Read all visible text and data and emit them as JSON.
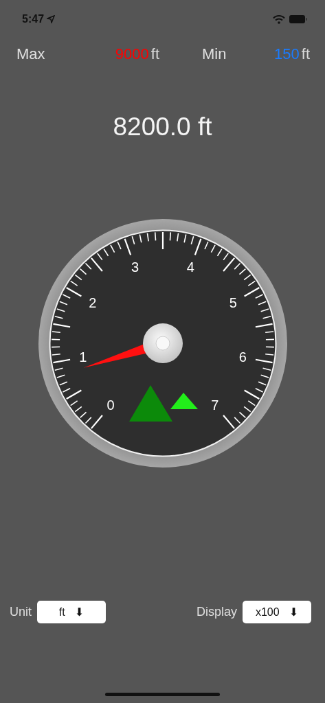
{
  "status_bar": {
    "time": "5:47"
  },
  "limits": [
    {
      "label": "Max",
      "value": "9000",
      "unit": "ft",
      "color": "#ff0000"
    },
    {
      "label": "Min",
      "value": "150",
      "unit": "ft",
      "color": "#1a7cff"
    }
  ],
  "reading": "8200.0 ft",
  "gauge": {
    "labels": [
      "0",
      "1",
      "2",
      "3",
      "4",
      "5",
      "6",
      "7"
    ]
  },
  "controls": [
    {
      "label": "Unit",
      "value": "ft",
      "icon": "⬇"
    },
    {
      "label": "Display",
      "value": "x100",
      "icon": "⬇"
    }
  ]
}
